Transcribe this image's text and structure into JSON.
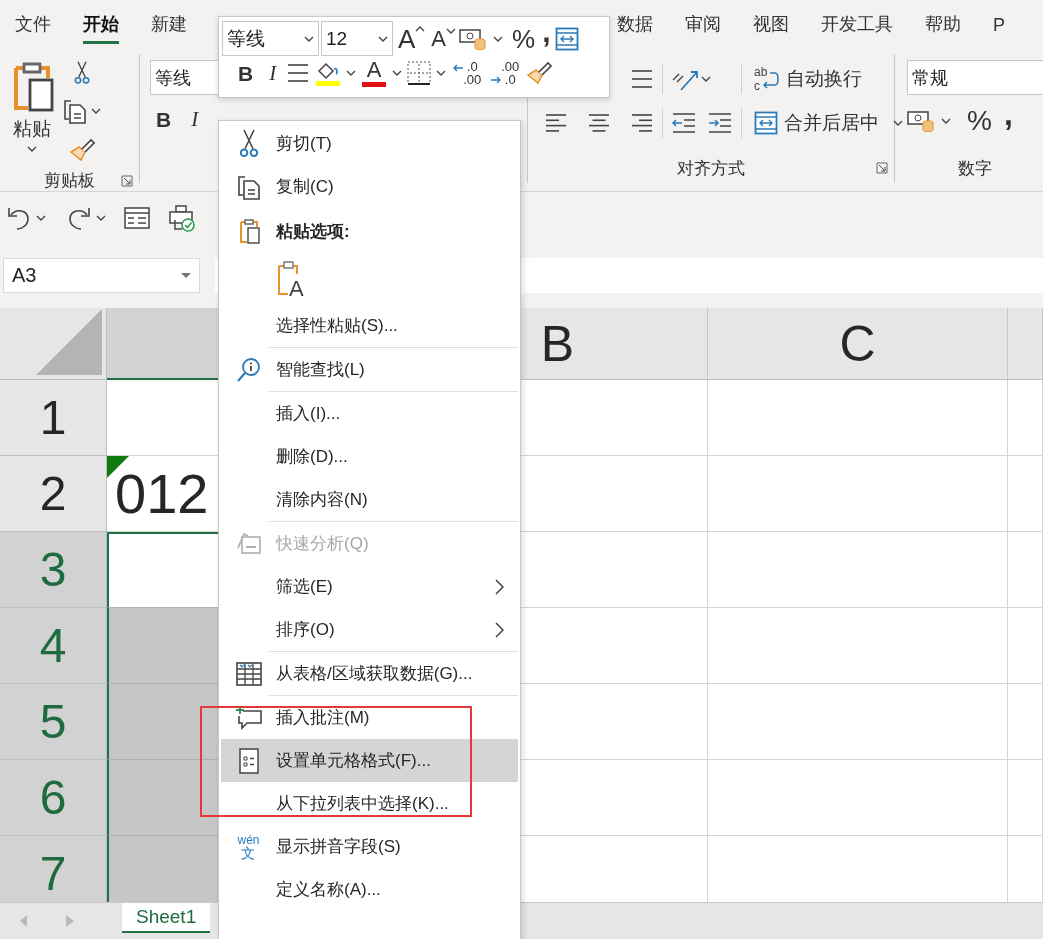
{
  "ribbon_tabs": [
    {
      "label": "文件",
      "selected": false
    },
    {
      "label": "开始",
      "selected": true
    },
    {
      "label": "新建",
      "selected": false
    },
    {
      "label": "数据",
      "selected": false
    },
    {
      "label": "审阅",
      "selected": false
    },
    {
      "label": "视图",
      "selected": false
    },
    {
      "label": "开发工具",
      "selected": false
    },
    {
      "label": "帮助",
      "selected": false
    },
    {
      "label": "P",
      "selected": false
    }
  ],
  "ribbon": {
    "clipboard": {
      "paste": "粘贴",
      "label": "剪贴板"
    },
    "font": {
      "font_name": "等线",
      "bold": "B",
      "italic": "I"
    },
    "alignment": {
      "wrap_glyph": [
        "ab",
        "c"
      ],
      "wrap_text": "自动换行",
      "merge": "合并后居中",
      "label": "对齐方式"
    },
    "number": {
      "format": "常规",
      "percent": "%",
      "comma": ",",
      "label": "数字"
    }
  },
  "name_box": {
    "value": "A3"
  },
  "mini_toolbar": {
    "font_name": "等线",
    "font_size": "12",
    "grow_font": "A",
    "shrink_font": "A",
    "percent": "%",
    "comma": ",",
    "bold": "B",
    "italic": "I",
    "font_color": "A",
    "add_decimal": [
      ".0",
      ".00"
    ],
    "remove_decimal": [
      ".00",
      ".0"
    ]
  },
  "context_menu": {
    "items": [
      {
        "kind": "command",
        "label": "剪切(T)",
        "disabled": false,
        "selected": false,
        "submenu": false
      },
      {
        "kind": "command",
        "label": "复制(C)",
        "disabled": false,
        "selected": false,
        "submenu": false
      },
      {
        "kind": "header",
        "label": "粘贴选项:"
      },
      {
        "kind": "paste_option",
        "glyph": "A"
      },
      {
        "kind": "command",
        "label": "选择性粘贴(S)...",
        "disabled": false,
        "selected": false,
        "submenu": false
      },
      {
        "kind": "separator"
      },
      {
        "kind": "command",
        "label": "智能查找(L)",
        "disabled": false,
        "selected": false,
        "submenu": false
      },
      {
        "kind": "separator"
      },
      {
        "kind": "command",
        "label": "插入(I)...",
        "disabled": false,
        "selected": false,
        "submenu": false
      },
      {
        "kind": "command",
        "label": "删除(D)...",
        "disabled": false,
        "selected": false,
        "submenu": false
      },
      {
        "kind": "command",
        "label": "清除内容(N)",
        "disabled": false,
        "selected": false,
        "submenu": false
      },
      {
        "kind": "separator"
      },
      {
        "kind": "command",
        "label": "快速分析(Q)",
        "disabled": true,
        "selected": false,
        "submenu": false
      },
      {
        "kind": "command",
        "label": "筛选(E)",
        "disabled": false,
        "selected": false,
        "submenu": true
      },
      {
        "kind": "command",
        "label": "排序(O)",
        "disabled": false,
        "selected": false,
        "submenu": true
      },
      {
        "kind": "separator"
      },
      {
        "kind": "command",
        "label": "从表格/区域获取数据(G)...",
        "disabled": false,
        "selected": false,
        "submenu": false
      },
      {
        "kind": "separator"
      },
      {
        "kind": "command",
        "label": "插入批注(M)",
        "disabled": false,
        "selected": false,
        "submenu": false
      },
      {
        "kind": "command",
        "label": "设置单元格格式(F)...",
        "disabled": false,
        "selected": true,
        "submenu": false
      },
      {
        "kind": "command",
        "label": "从下拉列表中选择(K)...",
        "disabled": false,
        "selected": false,
        "submenu": false
      },
      {
        "kind": "command",
        "label": "显示拼音字段(S)",
        "glyph": [
          "wén",
          "文"
        ],
        "disabled": false,
        "selected": false,
        "submenu": false
      },
      {
        "kind": "command",
        "label": "定义名称(A)...",
        "disabled": false,
        "selected": false,
        "submenu": false
      }
    ]
  },
  "grid": {
    "columns": [
      {
        "selected": true
      },
      {
        "label": "B",
        "selected": false
      },
      {
        "label": "C",
        "selected": false
      },
      {
        "selected": false
      }
    ],
    "rows": [
      {
        "number": "1",
        "selected": false,
        "active": false
      },
      {
        "number": "2",
        "selected": false,
        "active": false,
        "cells": [
          {
            "value": "012",
            "flag": true
          }
        ]
      },
      {
        "number": "3",
        "selected": true,
        "active": true
      },
      {
        "number": "4",
        "selected": true,
        "active": false
      },
      {
        "number": "5",
        "selected": true,
        "active": false
      },
      {
        "number": "6",
        "selected": true,
        "active": false
      },
      {
        "number": "7",
        "selected": true,
        "active": false
      }
    ]
  },
  "sheet_tabs": [
    {
      "label": "Sheet1",
      "selected": true
    }
  ]
}
